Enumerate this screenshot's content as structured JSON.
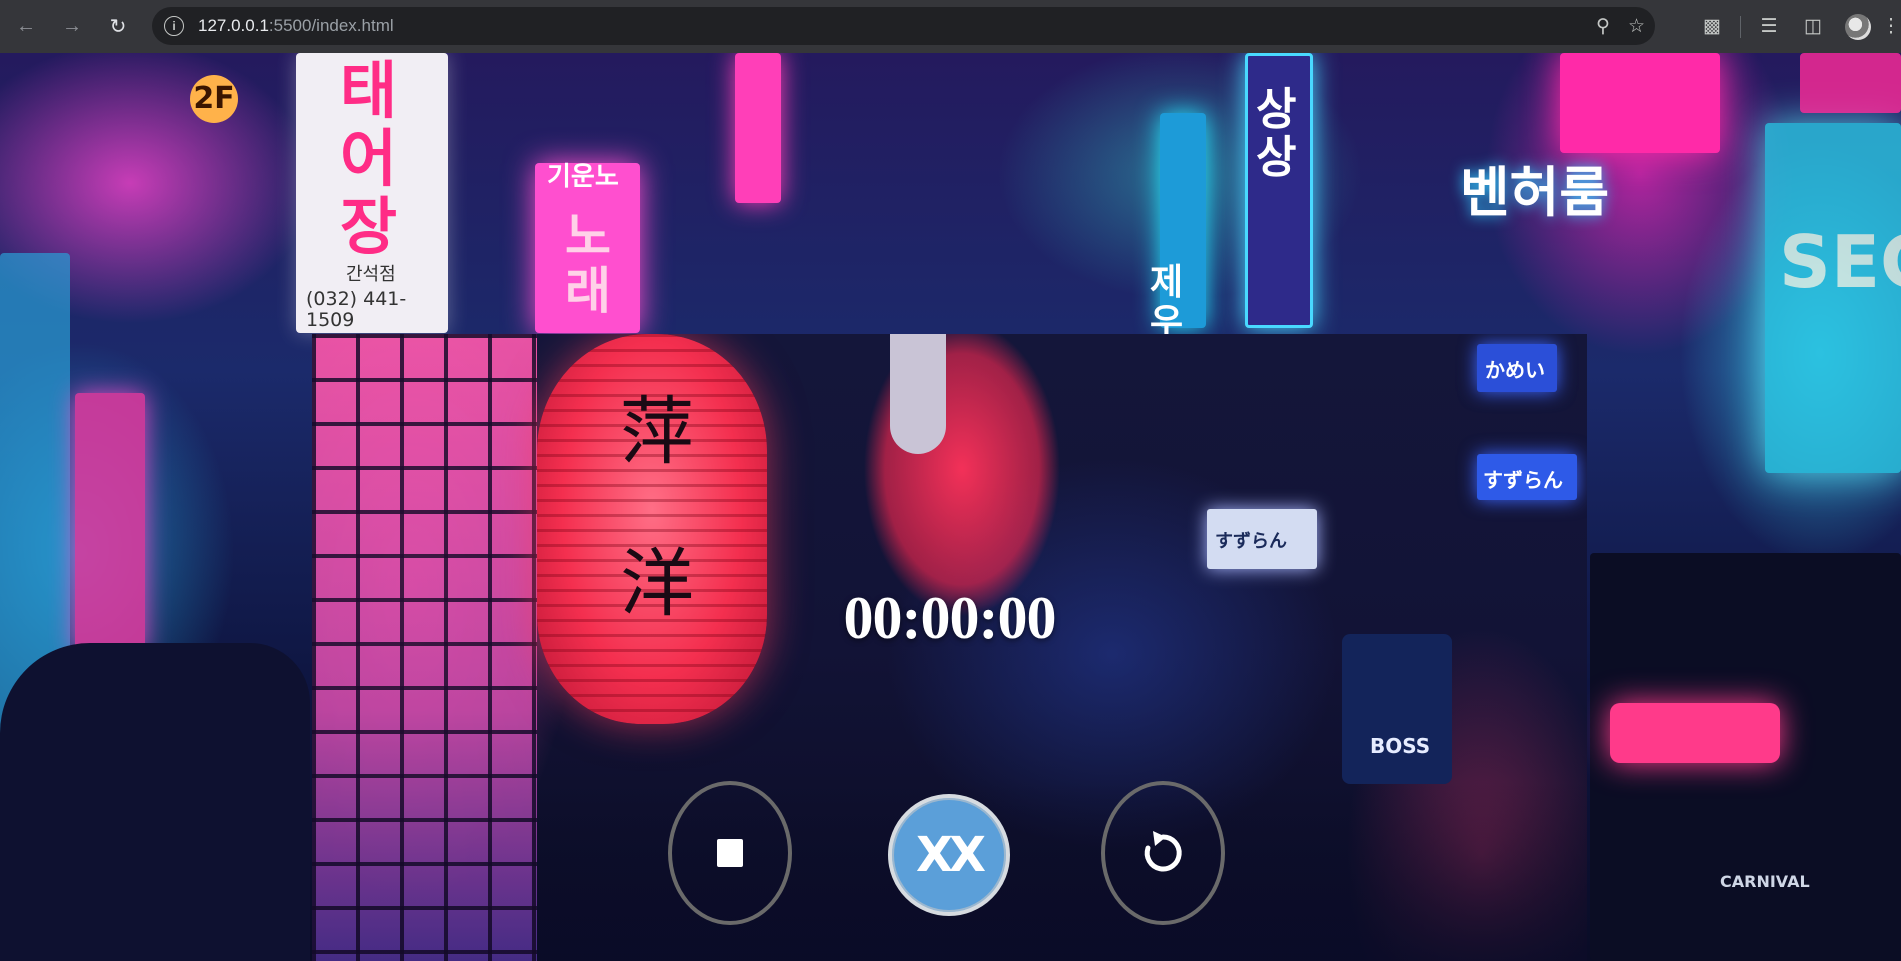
{
  "browser": {
    "url_host": "127.0.0.1",
    "url_path": ":5500/index.html",
    "nav": {
      "back_icon": "arrow-left-icon",
      "forward_icon": "arrow-right-icon",
      "reload_icon": "reload-icon"
    },
    "omnibox_icons": [
      "site-info-icon",
      "zoom-icon",
      "bookmark-star-icon"
    ],
    "toolbar_icons": [
      "extensions-icon",
      "media-queue-icon",
      "side-panel-icon",
      "profile-avatar",
      "kebab-menu-icon"
    ]
  },
  "background": {
    "signs": [
      {
        "text": "2F",
        "color": "#ff4fcf"
      },
      {
        "text": "태\n어\n장",
        "color": "#ff2c86"
      },
      {
        "text": "간석점",
        "color": "#333333"
      },
      {
        "text": "(032) 441-1509",
        "color": "#333333"
      },
      {
        "text": "기운노",
        "color": "#ffffff"
      },
      {
        "text": "노\n래",
        "color": "#ffb0d8"
      },
      {
        "text": "상\n상",
        "color": "#ffffff"
      },
      {
        "text": "제\n우",
        "color": "#ffffff"
      },
      {
        "text": "벤허룸",
        "color": "#ffffff"
      },
      {
        "text": "SECR",
        "color": "#e8fff0"
      },
      {
        "text": "CARNIVAL",
        "color": "#cfd6e6"
      }
    ]
  },
  "stopwatch": {
    "time": "00:00:00",
    "stop_button_icon": "stop-square-icon",
    "middle_button_icon": "double-x-icon",
    "middle_button_label": "XX",
    "reset_button_icon": "reset-arrow-icon",
    "lantern_chars": [
      "萍",
      "洋"
    ],
    "alley_signs": [
      "かめい",
      "すずらん",
      "すずらん",
      "BOSS"
    ]
  },
  "colors": {
    "browser_frame": "#35363a",
    "omnibox": "#202124",
    "timer_text": "#ffffff",
    "middle_button": "#5b9fd9",
    "control_ring": "#6a6a6a"
  }
}
